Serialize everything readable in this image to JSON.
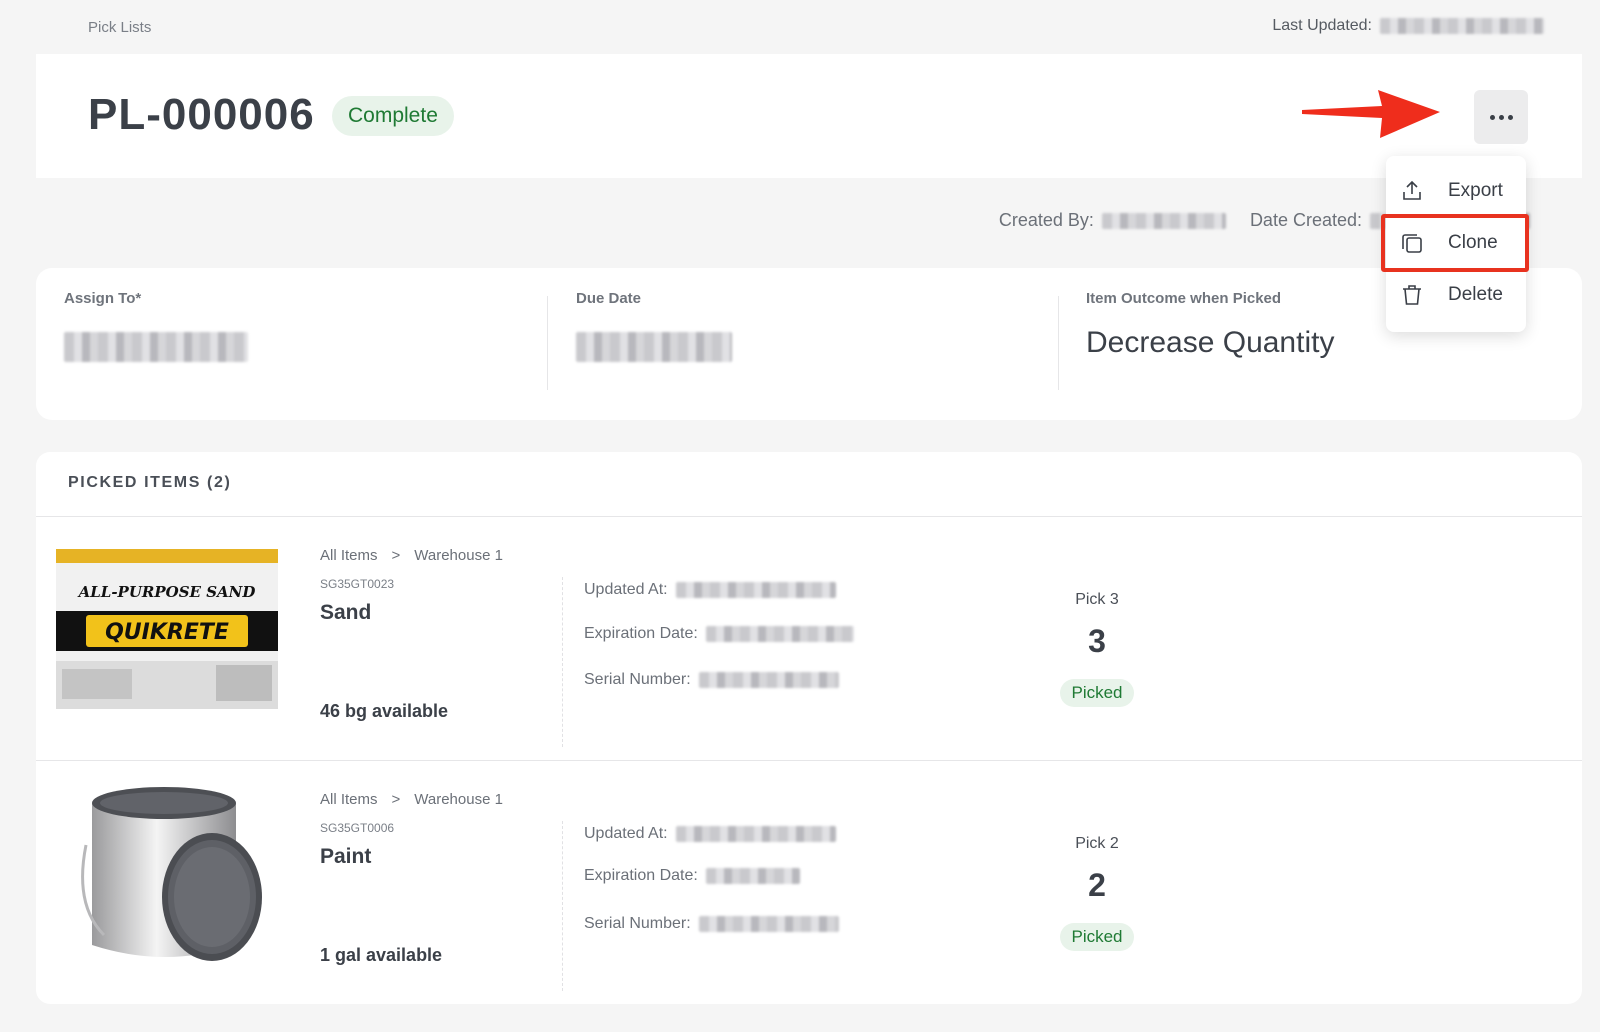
{
  "breadcrumb": "Pick Lists",
  "last_updated_label": "Last Updated:",
  "pick_list": {
    "id": "PL-000006",
    "status": "Complete"
  },
  "meta": {
    "created_by_label": "Created By:",
    "date_created_label": "Date Created:"
  },
  "menu": {
    "items": [
      {
        "label": "Export",
        "icon": "export-icon"
      },
      {
        "label": "Clone",
        "icon": "clone-icon"
      },
      {
        "label": "Delete",
        "icon": "trash-icon"
      }
    ]
  },
  "info": {
    "assign_to_label": "Assign To*",
    "due_date_label": "Due Date",
    "outcome_label": "Item Outcome when Picked",
    "outcome_value": "Decrease Quantity"
  },
  "items_section": {
    "header": "PICKED ITEMS (2)",
    "items": [
      {
        "path": [
          "All Items",
          ">",
          "Warehouse 1"
        ],
        "sku": "SG35GT0023",
        "name": "Sand",
        "available": "46 bg available",
        "updated_label": "Updated At:",
        "expiration_label": "Expiration Date:",
        "serial_label": "Serial Number:",
        "pick_label": "Pick 3",
        "pick_qty": "3",
        "picked_status": "Picked",
        "image_text": [
          "ALL-PURPOSE SAND",
          "QUIKRETE"
        ]
      },
      {
        "path": [
          "All Items",
          ">",
          "Warehouse 1"
        ],
        "sku": "SG35GT0006",
        "name": "Paint",
        "available": "1 gal available",
        "updated_label": "Updated At:",
        "expiration_label": "Expiration Date:",
        "serial_label": "Serial Number:",
        "pick_label": "Pick 2",
        "pick_qty": "2",
        "picked_status": "Picked"
      }
    ]
  },
  "colors": {
    "accent_green": "#1f7a34",
    "highlight_red": "#e8321f"
  }
}
